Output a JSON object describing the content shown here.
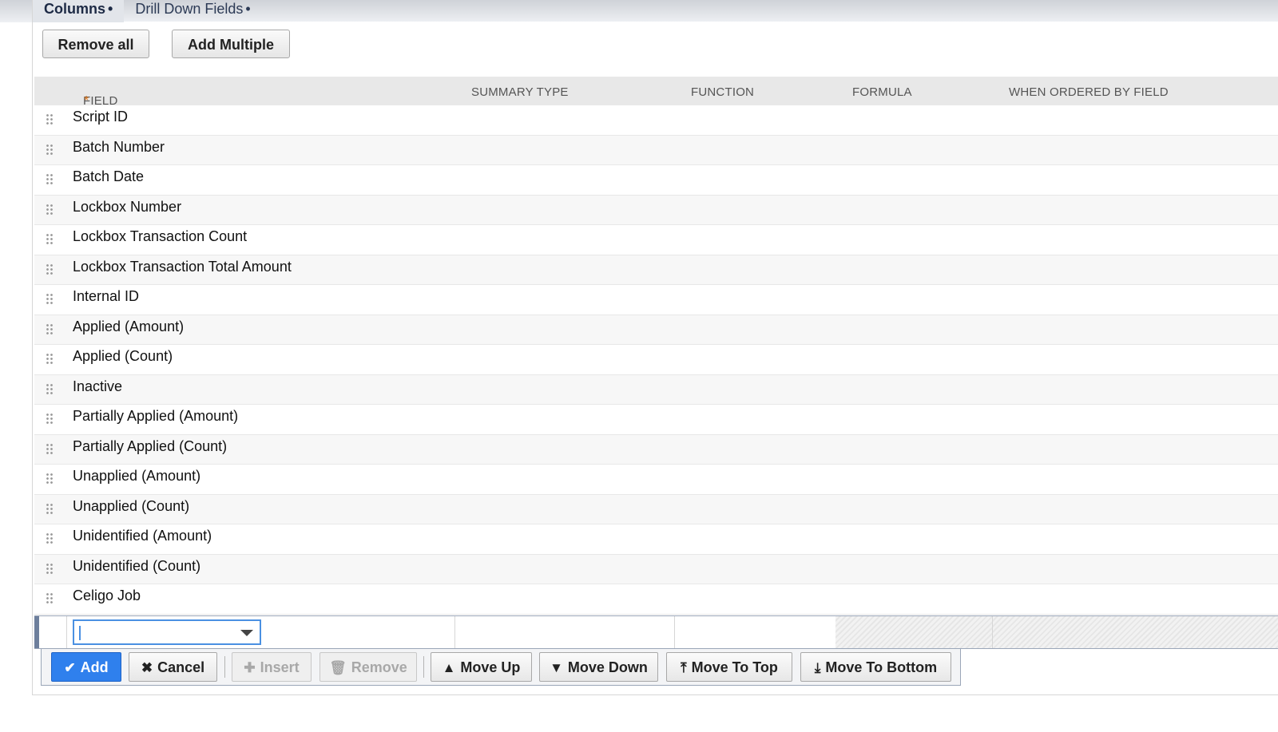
{
  "tabs": [
    {
      "label": "Columns",
      "marker": "•",
      "active": true
    },
    {
      "label": "Drill Down Fields",
      "marker": "•",
      "active": false
    }
  ],
  "actions": {
    "remove_all": "Remove all",
    "add_multiple": "Add Multiple"
  },
  "grid": {
    "headers": {
      "field": "FIELD",
      "field_required": "*",
      "summary_type": "SUMMARY TYPE",
      "function": "FUNCTION",
      "formula": "FORMULA",
      "when_ordered_by_field": "WHEN ORDERED BY FIELD"
    },
    "rows": [
      {
        "field": "Script ID"
      },
      {
        "field": "Batch Number"
      },
      {
        "field": "Batch Date"
      },
      {
        "field": "Lockbox Number"
      },
      {
        "field": "Lockbox Transaction Count"
      },
      {
        "field": "Lockbox Transaction Total Amount"
      },
      {
        "field": "Internal ID"
      },
      {
        "field": "Applied (Amount)"
      },
      {
        "field": "Applied (Count)"
      },
      {
        "field": "Inactive"
      },
      {
        "field": "Partially Applied (Amount)"
      },
      {
        "field": "Partially Applied (Count)"
      },
      {
        "field": "Unapplied (Amount)"
      },
      {
        "field": "Unapplied (Count)"
      },
      {
        "field": "Unidentified (Amount)"
      },
      {
        "field": "Unidentified (Count)"
      },
      {
        "field": "Celigo Job"
      }
    ],
    "edit_row": {
      "field_value": ""
    }
  },
  "toolbar": {
    "add": {
      "label": "Add",
      "icon": "check-icon"
    },
    "cancel": {
      "label": "Cancel",
      "icon": "x-icon"
    },
    "insert": {
      "label": "Insert",
      "icon": "plus-icon"
    },
    "remove": {
      "label": "Remove",
      "icon": "trash-icon"
    },
    "move_up": {
      "label": "Move Up",
      "icon": "arrow-up-icon"
    },
    "move_down": {
      "label": "Move Down",
      "icon": "arrow-down-icon"
    },
    "move_to_top": {
      "label": "Move To Top",
      "icon": "move-to-top-icon"
    },
    "move_to_bottom": {
      "label": "Move To Bottom",
      "icon": "move-to-bottom-icon"
    }
  },
  "colors": {
    "accent": "#2f80ed",
    "required": "#e07a1f",
    "header_bg": "#e8e8e8"
  }
}
